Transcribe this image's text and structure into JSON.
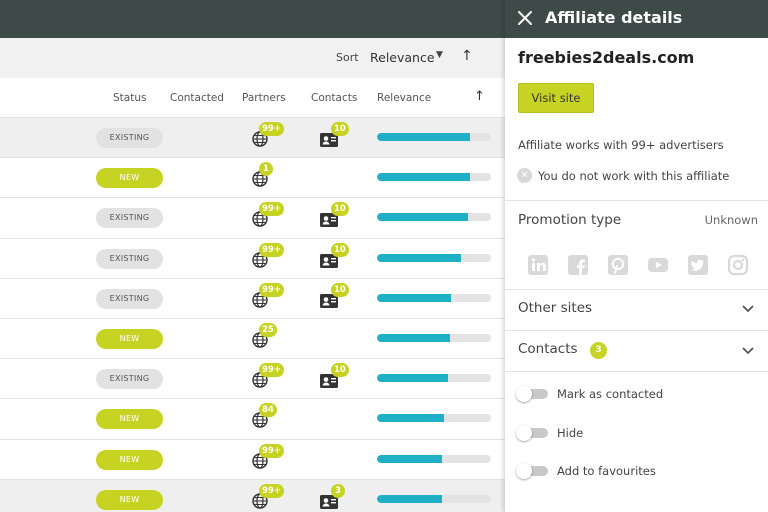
{
  "list": {
    "sort_label": "Sort",
    "sort_value": "Relevance",
    "columns": [
      "Status",
      "Contacted",
      "Partners",
      "Contacts",
      "Relevance"
    ],
    "rows": [
      {
        "status": "EXISTING",
        "partners": "99+",
        "contacts": "10",
        "relevance": 0.82
      },
      {
        "status": "NEW",
        "partners": "1",
        "contacts": "",
        "relevance": 0.82
      },
      {
        "status": "EXISTING",
        "partners": "99+",
        "contacts": "10",
        "relevance": 0.8
      },
      {
        "status": "EXISTING",
        "partners": "99+",
        "contacts": "10",
        "relevance": 0.74
      },
      {
        "status": "EXISTING",
        "partners": "99+",
        "contacts": "10",
        "relevance": 0.65
      },
      {
        "status": "NEW",
        "partners": "25",
        "contacts": "",
        "relevance": 0.64
      },
      {
        "status": "EXISTING",
        "partners": "99+",
        "contacts": "10",
        "relevance": 0.62
      },
      {
        "status": "NEW",
        "partners": "84",
        "contacts": "",
        "relevance": 0.59
      },
      {
        "status": "NEW",
        "partners": "99+",
        "contacts": "",
        "relevance": 0.57
      },
      {
        "status": "NEW",
        "partners": "99+",
        "contacts": "3",
        "relevance": 0.57
      }
    ]
  },
  "panel": {
    "title": "Affiliate details",
    "domain": "freebies2deals.com",
    "visit_label": "Visit site",
    "works_with": "Affiliate works with 99+ advertisers",
    "not_working": "You do not work with this affiliate",
    "promotion_label": "Promotion type",
    "promotion_value": "Unknown",
    "social_icons": [
      "linkedin-icon",
      "facebook-icon",
      "pinterest-icon",
      "youtube-icon",
      "twitter-icon",
      "instagram-icon"
    ],
    "other_sites_label": "Other sites",
    "contacts_label": "Contacts",
    "contacts_count": "3",
    "toggles": [
      {
        "label": "Mark as contacted",
        "on": false
      },
      {
        "label": "Hide",
        "on": false
      },
      {
        "label": "Add to favourites",
        "on": false
      }
    ]
  },
  "colors": {
    "header": "#3e4a48",
    "accent": "#c6d323",
    "relevance": "#1fb0c8",
    "existing_badge": "#e2e2e2"
  }
}
